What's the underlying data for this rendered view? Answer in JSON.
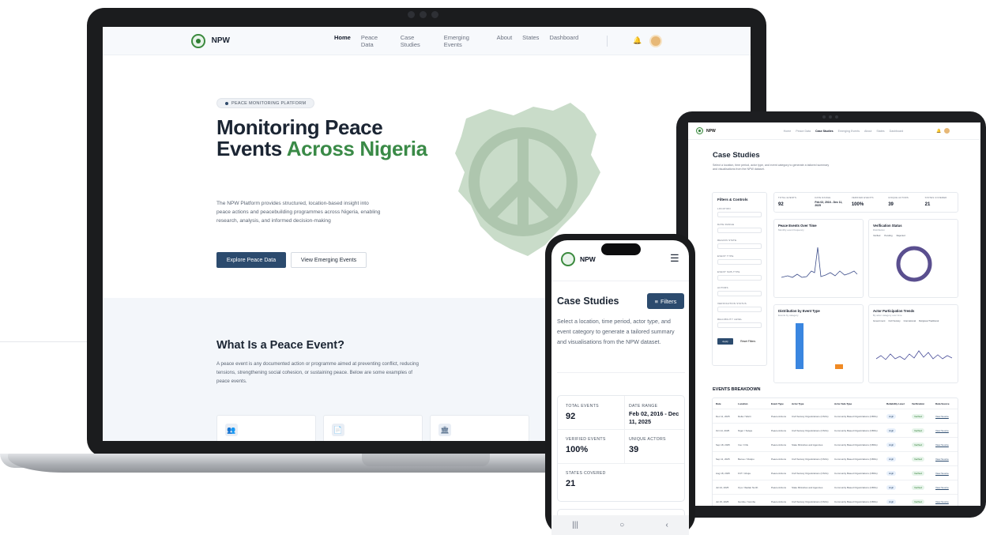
{
  "laptop": {
    "nav": {
      "brand": "NPW",
      "items": [
        "Home",
        "Peace Data",
        "Case Studies",
        "Emerging Events",
        "About",
        "States",
        "Dashboard"
      ]
    },
    "hero": {
      "badge": "PEACE MONITORING PLATFORM",
      "title_line1": "Monitoring Peace",
      "title_line2_a": "Events ",
      "title_line2_b": "Across Nigeria",
      "description": "The NPW Platform provides structured, location-based insight into peace actions and peacebuilding programmes across Nigeria, enabling research, analysis, and informed decision-making",
      "primary_button": "Explore Peace Data",
      "secondary_button": "View Emerging Events"
    },
    "section": {
      "title": "What Is a Peace Event?",
      "description": "A peace event is any documented action or programme aimed at preventing conflict, reducing tensions, strengthening social cohesion, or sustaining peace. Below are some examples of peace events."
    }
  },
  "tablet": {
    "nav": {
      "brand": "NPW",
      "items": [
        "Home",
        "Peace Data",
        "Case Studies",
        "Emerging Events",
        "About",
        "States",
        "Dashboard"
      ]
    },
    "title": "Case Studies",
    "subtitle": "Select a location, time period, actor type, and event category to generate a tailored summary and visualisations from the NPW dataset.",
    "filters": {
      "title": "Filters & Controls",
      "labels": [
        "LOCATION",
        "DATE RANGE",
        "REGION STATE",
        "EVENT TYPE",
        "EVENT SUB-TYPE",
        "ACTORS",
        "VERIFICATION STATUS",
        "RELIABILITY LEVEL"
      ],
      "apply": "Apply",
      "reset": "Reset Filters"
    },
    "stats": [
      {
        "label": "TOTAL EVENTS",
        "value": "92"
      },
      {
        "label": "DATE RANGE",
        "value": "Feb 02, 2016 - Dec 11, 2025"
      },
      {
        "label": "VERIFIED EVENTS",
        "value": "100%"
      },
      {
        "label": "UNIQUE ACTORS",
        "value": "39"
      },
      {
        "label": "STATES COVERED",
        "value": "21"
      }
    ],
    "panels": {
      "over_time_title": "Peace Events Over Time",
      "over_time_sub": "Monthly event frequency",
      "verification_title": "Verification Status",
      "verification_sub": "Distribution",
      "verification_legend": [
        "Verified",
        "Pending",
        "Rejected"
      ],
      "event_type_title": "Distribution by Event Type",
      "event_type_sub": "Events by category",
      "actor_title": "Actor Participation Trends",
      "actor_sub": "By actor category over time",
      "actor_legend": [
        "Government",
        "Civil Society",
        "International",
        "Religious/Traditional"
      ]
    },
    "table": {
      "title": "EVENTS BREAKDOWN",
      "headers": [
        "Date",
        "Location",
        "Event Type",
        "Actor Type",
        "Actor Sub-Type",
        "Reliability Level",
        "Verification",
        "Data Source"
      ],
      "rows": [
        [
          "Dec 11, 2025",
          "Delta / Warri",
          "Peace Actions",
          "Civil Society Organizations (CSOs)",
          "Community Based Organizations (CBOs)",
          "High",
          "Verified",
          "View Source"
        ],
        [
          "Oct 14, 2025",
          "Niger / Suleja",
          "Peace Actions",
          "Civil Society Organizations (CSOs)",
          "Community Based Organizations (CBOs)",
          "High",
          "Verified",
          "View Source"
        ],
        [
          "Sep 18, 2025",
          "Imo / Orlu",
          "Peace Actions",
          "State Ministries and Agencies",
          "Community Based Organizations (CBOs)",
          "High",
          "Verified",
          "View Source"
        ],
        [
          "Sep 11, 2025",
          "Benue / Otukpo",
          "Peace Actions",
          "Civil Society Organizations (CSOs)",
          "Community Based Organizations (CBOs)",
          "High",
          "Verified",
          "View Source"
        ],
        [
          "Aug 18, 2025",
          "FCT / Abuja",
          "Peace Actions",
          "Civil Society Organizations (CSOs)",
          "Community Based Organizations (CBOs)",
          "High",
          "Verified",
          "View Source"
        ],
        [
          "Jul 24, 2025",
          "Oyo / Ibadan North",
          "Peace Actions",
          "State Ministries and Agencies",
          "Community Based Organizations (CBOs)",
          "High",
          "Verified",
          "View Source"
        ],
        [
          "Jul 15, 2025",
          "Gombe / Gombe",
          "Peace Actions",
          "Civil Society Organizations (CSOs)",
          "Community Based Organizations (CBOs)",
          "High",
          "Verified",
          "View Source"
        ]
      ]
    }
  },
  "phone": {
    "brand": "NPW",
    "title": "Case Studies",
    "filters_button": "Filters",
    "description": "Select a location, time period, actor type, and event category to generate a tailored summary and visualisations from the NPW dataset.",
    "stats": {
      "total_label": "TOTAL EVENTS",
      "total_value": "92",
      "range_label": "DATE RANGE",
      "range_value": "Feb 02, 2016 - Dec 11, 2025",
      "verified_label": "VERIFIED EVENTS",
      "verified_value": "100%",
      "actors_label": "UNIQUE ACTORS",
      "actors_value": "39",
      "states_label": "STATES COVERED",
      "states_value": "21"
    },
    "system_bar": [
      "|||",
      "○",
      "‹"
    ]
  },
  "colors": {
    "navy": "#2c4b6e",
    "green": "#3a8a47",
    "map": "#c9dcc9"
  }
}
